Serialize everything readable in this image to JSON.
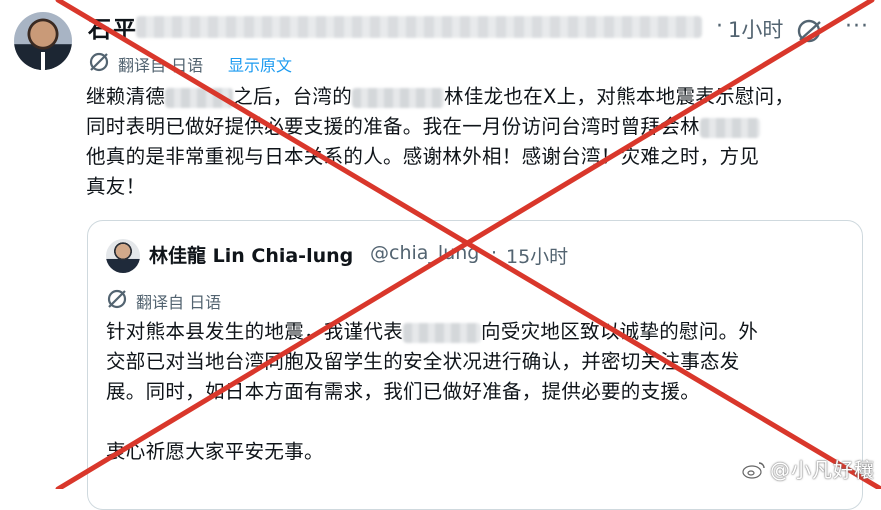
{
  "tweet": {
    "author_name": "石平",
    "separator": "·",
    "time": "1小时",
    "more_icon": "more-icon",
    "translate_label": "翻译自 日语",
    "show_original_label": "显示原文",
    "text_lines": [
      [
        "继赖清德",
        "之后，台湾的",
        "林佳龙也在X上，对熊本地震表示慰问，"
      ],
      [
        "同时表明已做好提供必要支援的准备。我在一月份访问台湾时曾拜会林",
        ""
      ],
      [
        "他真的是非常重视与日本关系的人。感谢林外相！感谢台湾！灾难之时，方见"
      ],
      [
        "真友！"
      ]
    ]
  },
  "quoted_tweet": {
    "author_name": "林佳龍 Lin Chia-lung",
    "handle": "@chia_lung",
    "separator": "·",
    "time": "15小时",
    "translate_label": "翻译自 日语",
    "text_lines": [
      [
        "针对熊本县发生的地震，我谨代表",
        "向受灾地区致以诚挚的慰问。外"
      ],
      [
        "交部已对当地台湾同胞及留学生的安全状况进行确认，并密切关注事态发"
      ],
      [
        "展。同时，如日本方面有需求，我们已做好准备，提供必要的支援。"
      ],
      [
        ""
      ],
      [
        "衷心祈愿大家平安无事。"
      ]
    ]
  },
  "overlay": {
    "cross_color": "#d9372b",
    "watermark_text": "@小凡好穰"
  },
  "colors": {
    "link": "#1d9bf0",
    "secondary_text": "#536471",
    "border": "#cfd9de"
  }
}
